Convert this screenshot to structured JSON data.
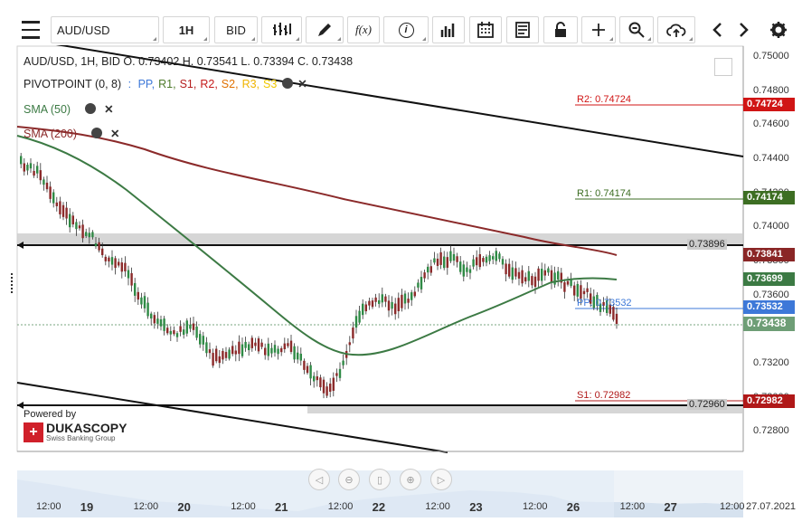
{
  "toolbar": {
    "symbol": "AUD/USD",
    "timeframe": "1H",
    "side": "BID",
    "icons": [
      "menu-icon",
      "bar-type-icon",
      "pencil-icon",
      "function-icon",
      "info-icon",
      "volume-icon",
      "calendar-icon",
      "report-icon",
      "lock-icon",
      "crosshair-icon",
      "zoom-icon",
      "upload-icon",
      "chevron-left-icon",
      "chevron-right-icon",
      "gear-icon"
    ],
    "fx_label": "f(x)",
    "info_label": "i"
  },
  "legend": {
    "ohlc": "AUD/USD, 1H, BID   O. 0.73402 H. 0.73541 L. 0.73394 C. 0.73438",
    "pivot_name": "PIVOTPOINT (0, 8)",
    "pivot_sep": ":",
    "pivot_items": [
      {
        "label": "PP,",
        "color": "#3d78d8"
      },
      {
        "label": "R1,",
        "color": "#4d7a2a"
      },
      {
        "label": "S1,",
        "color": "#b51f1f"
      },
      {
        "label": "R2,",
        "color": "#c41a1a"
      },
      {
        "label": "S2,",
        "color": "#e07000"
      },
      {
        "label": "R3,",
        "color": "#f0b400"
      },
      {
        "label": "S3",
        "color": "#f0c800"
      }
    ],
    "sma50": "SMA (50)",
    "sma200": "SMA (200)"
  },
  "price_axis": [
    "0.75000",
    "0.74800",
    "0.74600",
    "0.74400",
    "0.74200",
    "0.74000",
    "0.73800",
    "0.73600",
    "0.73400",
    "0.73200",
    "0.73000",
    "0.72800"
  ],
  "price_tags": [
    {
      "value": "0.74724",
      "color": "#d01515"
    },
    {
      "value": "0.74174",
      "color": "#3d6e23"
    },
    {
      "value": "0.73841",
      "color": "#8a2626"
    },
    {
      "value": "0.73699",
      "color": "#3c7a44"
    },
    {
      "value": "0.73532",
      "color": "#3d78d8"
    },
    {
      "value": "0.73438",
      "color": "#6e9e76"
    },
    {
      "value": "0.72982",
      "color": "#b01818"
    }
  ],
  "levels": {
    "r2": "R2: 0.74724",
    "r1": "R1: 0.74174",
    "pp": "PP: 0.73532",
    "s1": "S1: 0.72982",
    "h_upper": "0.73896",
    "h_lower": "0.72960"
  },
  "x_axis": [
    {
      "label": "12:00",
      "day": false
    },
    {
      "label": "19",
      "day": true
    },
    {
      "label": "12:00",
      "day": false
    },
    {
      "label": "20",
      "day": true
    },
    {
      "label": "12:00",
      "day": false
    },
    {
      "label": "21",
      "day": true
    },
    {
      "label": "12:00",
      "day": false
    },
    {
      "label": "22",
      "day": true
    },
    {
      "label": "12:00",
      "day": false
    },
    {
      "label": "23",
      "day": true
    },
    {
      "label": "12:00",
      "day": false
    },
    {
      "label": "26",
      "day": true
    },
    {
      "label": "12:00",
      "day": false
    },
    {
      "label": "27",
      "day": true
    },
    {
      "label": "12:00",
      "day": false
    },
    {
      "label": "27.07.2021",
      "day": false
    }
  ],
  "branding": {
    "powered_by": "Powered by",
    "brand": "DUKASCOPY",
    "tagline": "Swiss Banking Group"
  },
  "chart_data": {
    "type": "candlestick",
    "instrument": "AUD/USD",
    "timeframe": "1H",
    "ylim": [
      0.7275,
      0.7505
    ],
    "last_price": 0.73438,
    "ohlc_last": {
      "open": 0.73402,
      "high": 0.73541,
      "low": 0.73394,
      "close": 0.73438
    },
    "pivots": {
      "R2": 0.74724,
      "R1": 0.74174,
      "PP": 0.73532,
      "S1": 0.72982
    },
    "horizontal_lines": [
      0.73896,
      0.7296
    ],
    "sma50_last": 0.73699,
    "sma200_last": 0.73841
  }
}
